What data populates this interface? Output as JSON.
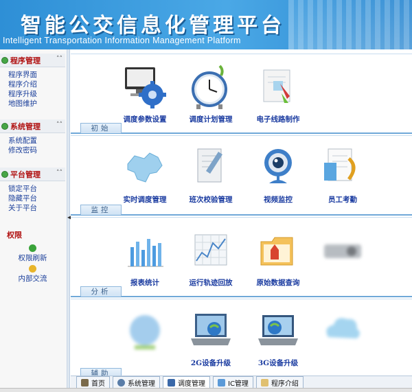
{
  "header": {
    "title_cn": "智能公交信息化管理平台",
    "title_en": "Intelligent Transportation Information Management Platform"
  },
  "sidebar": {
    "groups": [
      {
        "label": "程序管理",
        "items": [
          "程序界面",
          "程序介绍",
          "程序升级",
          "地图维护"
        ]
      },
      {
        "label": "系统管理",
        "items": [
          "系统配置",
          "修改密码"
        ]
      },
      {
        "label": "平台管理",
        "items": [
          "锁定平台",
          "隐藏平台",
          "关于平台"
        ]
      }
    ],
    "permissions": {
      "label": "权限",
      "items": [
        "权限刷新",
        "内部交流"
      ]
    }
  },
  "sections": [
    {
      "label": "初始",
      "tiles": [
        "调度参数设置",
        "调度计划管理",
        "电子线路制作"
      ]
    },
    {
      "label": "监控",
      "tiles": [
        "实时调度管理",
        "班次校验管理",
        "视频监控",
        "员工考勤"
      ]
    },
    {
      "label": "分析",
      "tiles": [
        "报表统计",
        "运行轨迹回放",
        "原始数据查询",
        ""
      ]
    },
    {
      "label": "辅助",
      "tiles": [
        "",
        "2G设备升级",
        "3G设备升级",
        ""
      ]
    }
  ],
  "tabs": [
    "首页",
    "系统管理",
    "调度管理",
    "IC管理",
    "程序介绍"
  ],
  "colors": {
    "header_blue": "#2e8fd6",
    "link_blue": "#1a3ba0",
    "group_red": "#b01010"
  }
}
